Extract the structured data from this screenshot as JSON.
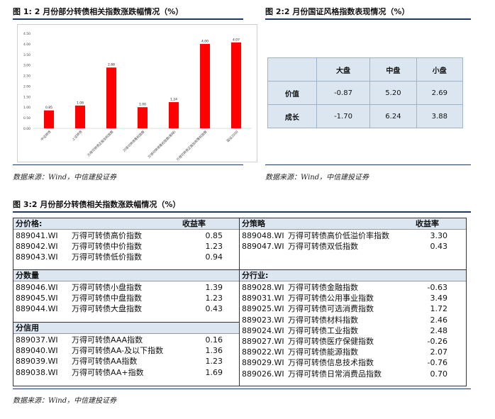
{
  "fig1": {
    "title": "图 1: 2 月份部分转债相关指数涨跌幅情况（%）",
    "source": "数据来源：Wind，中信建投证券"
  },
  "fig2": {
    "title": "图 2:2 月份国证风格指数表现情况（%）",
    "source": "数据来源：Wind，中信建投证券",
    "columns": [
      "大盘",
      "中盘",
      "小盘"
    ],
    "rows": [
      {
        "label": "价值",
        "values": [
          "-0.87",
          "5.20",
          "2.69"
        ]
      },
      {
        "label": "成长",
        "values": [
          "-1.70",
          "6.24",
          "3.88"
        ]
      }
    ]
  },
  "fig3": {
    "title": "图 3:2 月份部分转债相关指数涨跌幅情况（%）",
    "source": "数据来源：Wind，中信建投证券",
    "yield_label": "收益率",
    "sections_left": [
      {
        "head": "分价格:",
        "show_yield": true,
        "items": [
          {
            "code": "889041.WI",
            "name": "万得可转债高价指数",
            "value": "0.85"
          },
          {
            "code": "889042.WI",
            "name": "万得可转债中价指数",
            "value": "1.23"
          },
          {
            "code": "889043.WI",
            "name": "万得可转债低价指数",
            "value": "0.94"
          }
        ]
      },
      {
        "head": "分数量",
        "show_yield": false,
        "items": [
          {
            "code": "889046.WI",
            "name": "万得可转债小盘指数",
            "value": "1.39"
          },
          {
            "code": "889045.WI",
            "name": "万得可转债中盘指数",
            "value": "1.23"
          },
          {
            "code": "889044.WI",
            "name": "万得可转债大盘指数",
            "value": "0.43"
          }
        ]
      },
      {
        "head": "分信用",
        "show_yield": false,
        "items": [
          {
            "code": "889037.WI",
            "name": "万得可转债AAA指数",
            "value": "0.16"
          },
          {
            "code": "889040.WI",
            "name": "万得可转债AA-及以下指数",
            "value": "1.36"
          },
          {
            "code": "889039.WI",
            "name": "万得可转债AA指数",
            "value": "1.23"
          },
          {
            "code": "889038.WI",
            "name": "万得可转债AA+指数",
            "value": "1.69"
          }
        ]
      }
    ],
    "sections_right": [
      {
        "head": "分策略",
        "show_yield": true,
        "items": [
          {
            "code": "889048.WI",
            "name": "万得可转债高价低溢价率指数",
            "value": "3.30"
          },
          {
            "code": "889047.WI",
            "name": "万得可转债双低指数",
            "value": "0.43"
          }
        ]
      },
      {
        "head": "分行业:",
        "show_yield": false,
        "items": [
          {
            "code": "889028.WI",
            "name": "万得可转债金融指数",
            "value": "-0.63"
          },
          {
            "code": "889031.WI",
            "name": "万得可转债公用事业指数",
            "value": "3.49"
          },
          {
            "code": "889025.WI",
            "name": "万得可转债可选消费指数",
            "value": "1.72"
          },
          {
            "code": "889023.WI",
            "name": "万得可转债材料指数",
            "value": "2.46"
          },
          {
            "code": "889024.WI",
            "name": "万得可转债工业指数",
            "value": "2.48"
          },
          {
            "code": "889027.WI",
            "name": "万得可转债医疗保健指数",
            "value": "-0.26"
          },
          {
            "code": "889022.WI",
            "name": "万得可转债能源指数",
            "value": "2.07"
          },
          {
            "code": "889029.WI",
            "name": "万得可转债信息技术指数",
            "value": "-0.76"
          },
          {
            "code": "889026.WI",
            "name": "万得可转债日常消费品指数",
            "value": "0.70"
          }
        ]
      }
    ]
  },
  "chart_data": {
    "type": "bar",
    "categories": [
      "中证转债",
      "上证转债",
      "万得可转债正股加权指数",
      "万得可转债等权指数",
      "万得可转债等权指数(剔除)",
      "万得可转债正股加权等权指数",
      "国证2000"
    ],
    "values": [
      0.85,
      1.08,
      2.88,
      1.0,
      1.24,
      4.0,
      4.07
    ],
    "value_labels": [
      "0.85",
      "1.08",
      "2.88",
      "1.00",
      "1.24",
      "4.00",
      "4.07"
    ],
    "ylim": [
      0,
      4.5
    ],
    "yticks": [
      "0.00",
      "0.50",
      "1.00",
      "1.50",
      "2.00",
      "2.50",
      "3.00",
      "3.50",
      "4.00",
      "4.50"
    ],
    "color": "#ff0000",
    "grid": false
  }
}
